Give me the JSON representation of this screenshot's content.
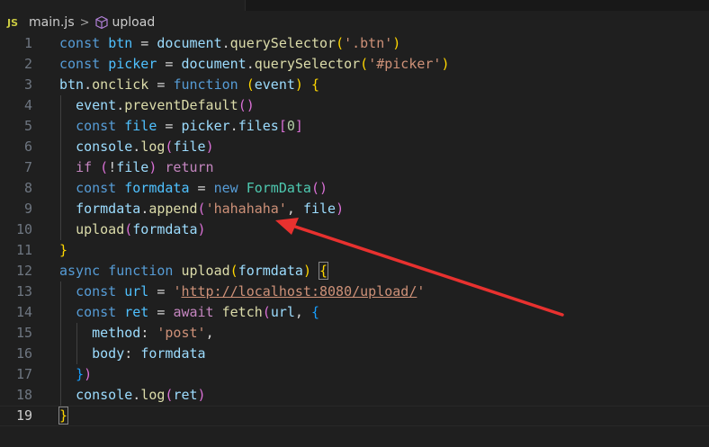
{
  "breadcrumb": {
    "lang_badge": "JS",
    "file": "main.js",
    "separator": ">",
    "symbol_icon": "cube-method-icon",
    "symbol": "upload"
  },
  "editor": {
    "current_line": 19,
    "lines": [
      {
        "n": "1",
        "tokens": [
          [
            "kw",
            "const "
          ],
          [
            "const",
            "btn"
          ],
          [
            "punc",
            " = "
          ],
          [
            "var",
            "document"
          ],
          [
            "punc",
            "."
          ],
          [
            "fn",
            "querySelector"
          ],
          [
            "b1",
            "("
          ],
          [
            "str",
            "'.btn'"
          ],
          [
            "b1",
            ")"
          ]
        ]
      },
      {
        "n": "2",
        "tokens": [
          [
            "kw",
            "const "
          ],
          [
            "const",
            "picker"
          ],
          [
            "punc",
            " = "
          ],
          [
            "var",
            "document"
          ],
          [
            "punc",
            "."
          ],
          [
            "fn",
            "querySelector"
          ],
          [
            "b1",
            "("
          ],
          [
            "str",
            "'#picker'"
          ],
          [
            "b1",
            ")"
          ]
        ]
      },
      {
        "n": "3",
        "tokens": [
          [
            "var",
            "btn"
          ],
          [
            "punc",
            "."
          ],
          [
            "fn",
            "onclick"
          ],
          [
            "punc",
            " = "
          ],
          [
            "kw",
            "function "
          ],
          [
            "b1",
            "("
          ],
          [
            "var",
            "event"
          ],
          [
            "b1",
            ")"
          ],
          [
            "punc",
            " "
          ],
          [
            "b1",
            "{"
          ]
        ]
      },
      {
        "n": "4",
        "tokens": [
          [
            "punc",
            "  "
          ],
          [
            "var",
            "event"
          ],
          [
            "punc",
            "."
          ],
          [
            "fn",
            "preventDefault"
          ],
          [
            "b2",
            "()"
          ]
        ]
      },
      {
        "n": "5",
        "tokens": [
          [
            "punc",
            "  "
          ],
          [
            "kw",
            "const "
          ],
          [
            "const",
            "file"
          ],
          [
            "punc",
            " = "
          ],
          [
            "var",
            "picker"
          ],
          [
            "punc",
            "."
          ],
          [
            "var",
            "files"
          ],
          [
            "b2",
            "["
          ],
          [
            "num",
            "0"
          ],
          [
            "b2",
            "]"
          ]
        ]
      },
      {
        "n": "6",
        "tokens": [
          [
            "punc",
            "  "
          ],
          [
            "var",
            "console"
          ],
          [
            "punc",
            "."
          ],
          [
            "fn",
            "log"
          ],
          [
            "b2",
            "("
          ],
          [
            "var",
            "file"
          ],
          [
            "b2",
            ")"
          ]
        ]
      },
      {
        "n": "7",
        "tokens": [
          [
            "punc",
            "  "
          ],
          [
            "ctrl",
            "if "
          ],
          [
            "b2",
            "("
          ],
          [
            "punc",
            "!"
          ],
          [
            "var",
            "file"
          ],
          [
            "b2",
            ")"
          ],
          [
            "punc",
            " "
          ],
          [
            "ctrl",
            "return"
          ]
        ]
      },
      {
        "n": "8",
        "tokens": [
          [
            "punc",
            "  "
          ],
          [
            "kw",
            "const "
          ],
          [
            "const",
            "formdata"
          ],
          [
            "punc",
            " = "
          ],
          [
            "kw",
            "new "
          ],
          [
            "class",
            "FormData"
          ],
          [
            "b2",
            "()"
          ]
        ]
      },
      {
        "n": "9",
        "tokens": [
          [
            "punc",
            "  "
          ],
          [
            "var",
            "formdata"
          ],
          [
            "punc",
            "."
          ],
          [
            "fn",
            "append"
          ],
          [
            "b2",
            "("
          ],
          [
            "str",
            "'hahahaha'"
          ],
          [
            "punc",
            ", "
          ],
          [
            "var",
            "file"
          ],
          [
            "b2",
            ")"
          ]
        ]
      },
      {
        "n": "10",
        "tokens": [
          [
            "punc",
            "  "
          ],
          [
            "fn",
            "upload"
          ],
          [
            "b2",
            "("
          ],
          [
            "var",
            "formdata"
          ],
          [
            "b2",
            ")"
          ]
        ]
      },
      {
        "n": "11",
        "tokens": [
          [
            "b1",
            "}"
          ]
        ]
      },
      {
        "n": "12",
        "tokens": [
          [
            "kw",
            "async "
          ],
          [
            "kw",
            "function "
          ],
          [
            "fn",
            "upload"
          ],
          [
            "b1",
            "("
          ],
          [
            "var",
            "formdata"
          ],
          [
            "b1",
            ")"
          ],
          [
            "punc",
            " "
          ],
          [
            "b1",
            "{"
          ]
        ]
      },
      {
        "n": "13",
        "tokens": [
          [
            "punc",
            "  "
          ],
          [
            "kw",
            "const "
          ],
          [
            "const",
            "url"
          ],
          [
            "punc",
            " = "
          ],
          [
            "str",
            "'"
          ],
          [
            "url",
            "http://localhost:8080/upload/"
          ],
          [
            "str",
            "'"
          ]
        ]
      },
      {
        "n": "14",
        "tokens": [
          [
            "punc",
            "  "
          ],
          [
            "kw",
            "const "
          ],
          [
            "const",
            "ret"
          ],
          [
            "punc",
            " = "
          ],
          [
            "ctrl",
            "await "
          ],
          [
            "fn",
            "fetch"
          ],
          [
            "b2",
            "("
          ],
          [
            "var",
            "url"
          ],
          [
            "punc",
            ", "
          ],
          [
            "b3",
            "{"
          ]
        ]
      },
      {
        "n": "15",
        "tokens": [
          [
            "punc",
            "    "
          ],
          [
            "var",
            "method"
          ],
          [
            "punc",
            ": "
          ],
          [
            "str",
            "'post'"
          ],
          [
            "punc",
            ","
          ]
        ]
      },
      {
        "n": "16",
        "tokens": [
          [
            "punc",
            "    "
          ],
          [
            "var",
            "body"
          ],
          [
            "punc",
            ": "
          ],
          [
            "var",
            "formdata"
          ]
        ]
      },
      {
        "n": "17",
        "tokens": [
          [
            "punc",
            "  "
          ],
          [
            "b3",
            "}"
          ],
          [
            "b2",
            ")"
          ]
        ]
      },
      {
        "n": "18",
        "tokens": [
          [
            "punc",
            "  "
          ],
          [
            "var",
            "console"
          ],
          [
            "punc",
            "."
          ],
          [
            "fn",
            "log"
          ],
          [
            "b2",
            "("
          ],
          [
            "var",
            "ret"
          ],
          [
            "b2",
            ")"
          ]
        ]
      },
      {
        "n": "19",
        "tokens": [
          [
            "b1",
            "}"
          ]
        ]
      }
    ]
  },
  "annotation": {
    "arrow_color": "#e8312f"
  }
}
